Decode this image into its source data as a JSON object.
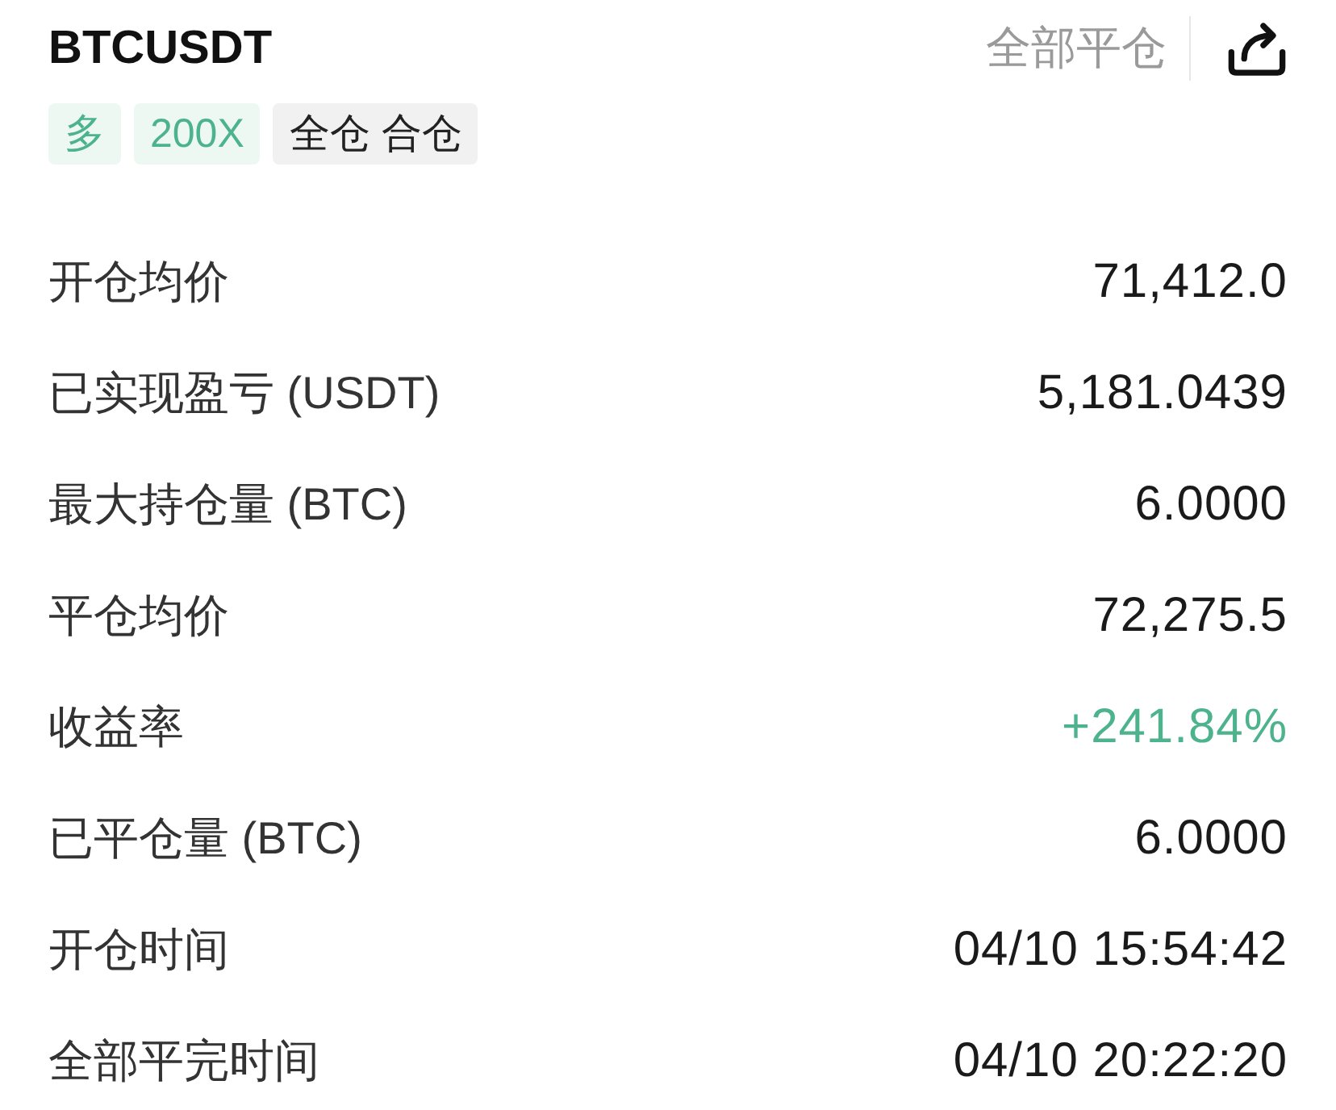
{
  "header": {
    "symbol": "BTCUSDT",
    "close_all": "全部平仓"
  },
  "tags": [
    {
      "label": "多",
      "kind": "accent"
    },
    {
      "label": "200X",
      "kind": "accent"
    },
    {
      "label": "全仓 合仓",
      "kind": "plain"
    }
  ],
  "rows": [
    {
      "label": "开仓均价",
      "value": "71,412.0",
      "color": "#1a1a1a"
    },
    {
      "label": "已实现盈亏 (USDT)",
      "value": "5,181.0439",
      "color": "#1a1a1a"
    },
    {
      "label": "最大持仓量 (BTC)",
      "value": "6.0000",
      "color": "#1a1a1a"
    },
    {
      "label": "平仓均价",
      "value": "72,275.5",
      "color": "#1a1a1a"
    },
    {
      "label": "收益率",
      "value": "+241.84%",
      "color": "#4db38d"
    },
    {
      "label": "已平仓量 (BTC)",
      "value": "6.0000",
      "color": "#1a1a1a"
    },
    {
      "label": "开仓时间",
      "value": "04/10 15:54:42",
      "color": "#1a1a1a"
    },
    {
      "label": "全部平完时间",
      "value": "04/10 20:22:20",
      "color": "#1a1a1a"
    }
  ]
}
